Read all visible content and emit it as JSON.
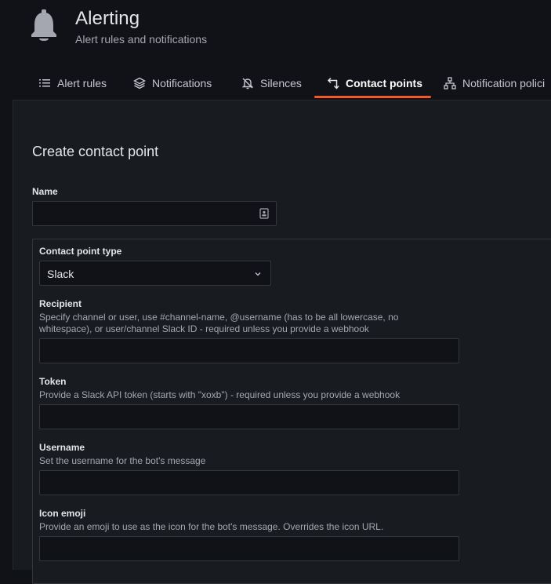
{
  "header": {
    "title": "Alerting",
    "subtitle": "Alert rules and notifications",
    "icon": "bell-icon"
  },
  "tabs": [
    {
      "label": "Alert rules",
      "icon": "list-icon",
      "active": false
    },
    {
      "label": "Notifications",
      "icon": "layers-icon",
      "active": false
    },
    {
      "label": "Silences",
      "icon": "bell-slash-icon",
      "active": false
    },
    {
      "label": "Contact points",
      "icon": "comment-alt-share-icon",
      "active": true
    },
    {
      "label": "Notification polici",
      "icon": "sitemap-icon",
      "active": false
    }
  ],
  "accent_color": "#f05a28",
  "form": {
    "heading": "Create contact point",
    "name": {
      "label": "Name",
      "value": "",
      "placeholder": ""
    },
    "contact_point_type": {
      "label": "Contact point type",
      "value": "Slack"
    },
    "fields": [
      {
        "label": "Recipient",
        "description": "Specify channel or user, use #channel-name, @username (has to be all lowercase, no whitespace), or user/channel Slack ID - required unless you provide a webhook",
        "value": ""
      },
      {
        "label": "Token",
        "description": "Provide a Slack API token (starts with \"xoxb\") - required unless you provide a webhook",
        "value": ""
      },
      {
        "label": "Username",
        "description": "Set the username for the bot's message",
        "value": ""
      },
      {
        "label": "Icon emoji",
        "description": "Provide an emoji to use as the icon for the bot's message. Overrides the icon URL.",
        "value": ""
      }
    ]
  }
}
